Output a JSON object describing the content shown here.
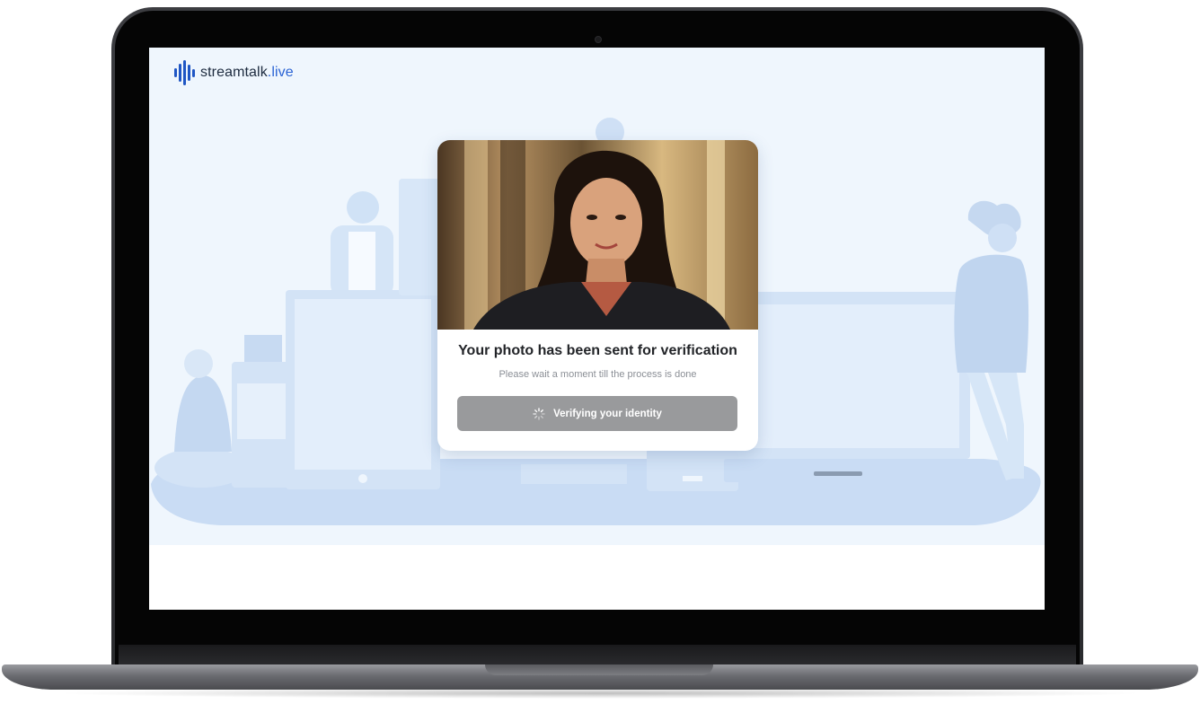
{
  "brand": {
    "name": "streamtalk",
    "tld": ".live",
    "color": "#1f56c4"
  },
  "verification": {
    "title": "Your photo has been sent for verification",
    "subtitle": "Please wait a moment till the process is done",
    "button_label": "Verifying your identity",
    "button_icon": "spinner-icon",
    "button_color": "#999a9c"
  },
  "colors": {
    "screen_background": "#eff6fd",
    "illustration": "#c9dcf4"
  }
}
